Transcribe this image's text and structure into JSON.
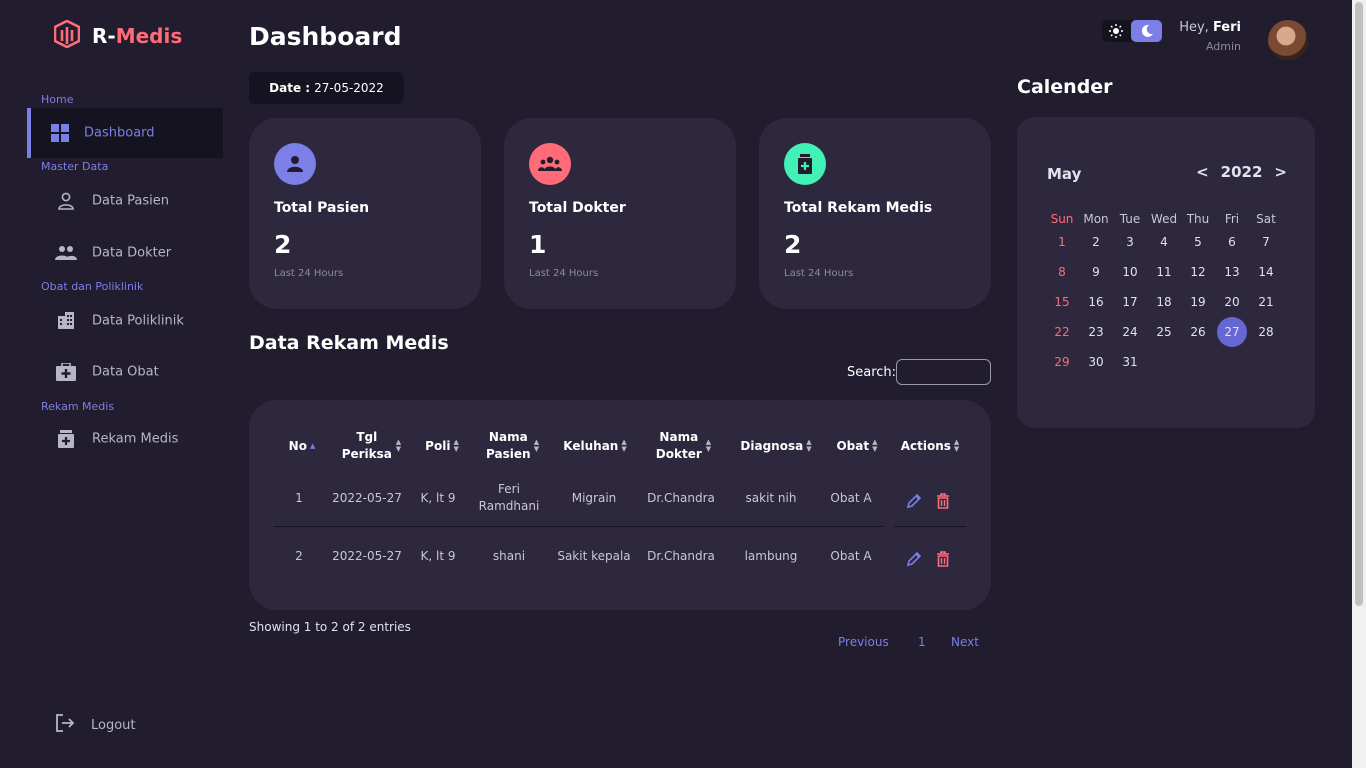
{
  "brand": {
    "name_r": "R-",
    "name_medis": "Medis"
  },
  "sidebar": {
    "sections": [
      {
        "label": "Home"
      },
      {
        "label": "Master Data"
      },
      {
        "label": "Obat dan Poliklinik"
      },
      {
        "label": "Rekam Medis"
      }
    ],
    "items": [
      {
        "label": "Dashboard",
        "icon": "grid-icon"
      },
      {
        "label": "Data Pasien",
        "icon": "user-icon"
      },
      {
        "label": "Data Dokter",
        "icon": "group-icon"
      },
      {
        "label": "Data Poliklinik",
        "icon": "building-icon"
      },
      {
        "label": "Data Obat",
        "icon": "medkit-icon"
      },
      {
        "label": "Rekam Medis",
        "icon": "medicine-bottle-icon"
      }
    ],
    "logout": "Logout"
  },
  "header": {
    "title": "Dashboard",
    "date_label": "Date :",
    "date_value": "27-05-2022",
    "greeting_prefix": "Hey,",
    "user_name": "Feri",
    "user_role": "Admin"
  },
  "stats": [
    {
      "title": "Total Pasien",
      "value": "2",
      "sub": "Last 24 Hours",
      "color": "#7b7fe6",
      "icon": "user-icon"
    },
    {
      "title": "Total Dokter",
      "value": "1",
      "sub": "Last 24 Hours",
      "color": "#ff6b78",
      "icon": "group-icon"
    },
    {
      "title": "Total Rekam Medis",
      "value": "2",
      "sub": "Last 24 Hours",
      "color": "#41f1b6",
      "icon": "medicine-bottle-icon"
    }
  ],
  "records": {
    "title": "Data Rekam Medis",
    "search_label": "Search:",
    "columns": [
      "No",
      "Tgl Periksa",
      "Poli",
      "Nama Pasien",
      "Keluhan",
      "Nama Dokter",
      "Diagnosa",
      "Obat",
      "Actions"
    ],
    "rows": [
      {
        "no": "1",
        "tgl": "2022-05-27",
        "poli": "K, lt 9",
        "pasien": "Feri Ramdhani",
        "keluhan": "Migrain",
        "dokter": "Dr.Chandra",
        "diagnosa": "sakit nih",
        "obat": "Obat A"
      },
      {
        "no": "2",
        "tgl": "2022-05-27",
        "poli": "K, lt 9",
        "pasien": "shani",
        "keluhan": "Sakit kepala",
        "dokter": "Dr.Chandra",
        "diagnosa": "lambung",
        "obat": "Obat A"
      }
    ],
    "showing": "Showing 1 to 2 of 2 entries",
    "pager": {
      "previous": "Previous",
      "page": "1",
      "next": "Next"
    }
  },
  "calendar": {
    "title": "Calender",
    "month": "May",
    "year": "2022",
    "prev": "<",
    "next": ">",
    "weekdays": [
      "Sun",
      "Mon",
      "Tue",
      "Wed",
      "Thu",
      "Fri",
      "Sat"
    ],
    "first_weekday_index": 0,
    "days_in_month": 31,
    "today": 27
  },
  "colors": {
    "accent": "#7b7fe6",
    "danger": "#ff6b78",
    "success": "#41f1b6"
  }
}
